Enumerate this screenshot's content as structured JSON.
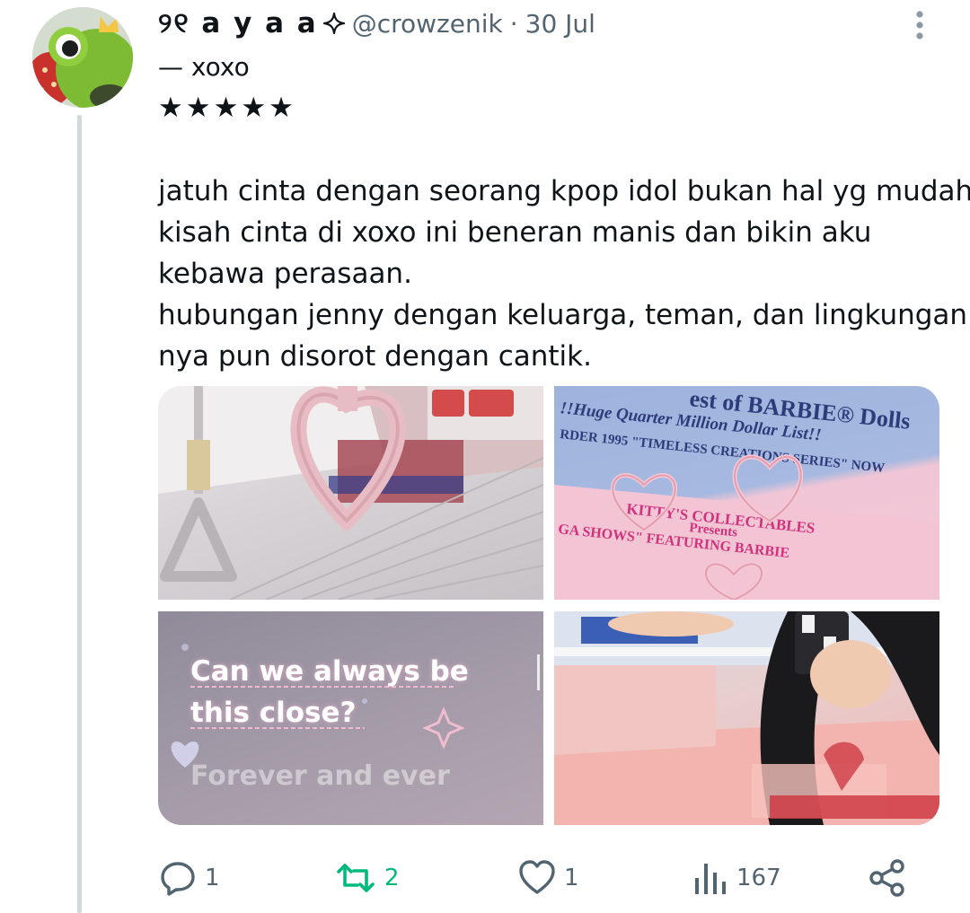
{
  "tweet": {
    "display_name": "୨୧ a y a a",
    "handle": "@crowzenik",
    "separator": "·",
    "date": "30 Jul",
    "line1": "— xoxo",
    "line2": "★★★★★",
    "body_lines": [
      "jatuh cinta dengan seorang kpop idol bukan hal yg mudah.",
      "kisah cinta di xoxo ini beneran manis dan bikin aku",
      "kebawa perasaan.",
      "hubungan jenny dengan keluarga, teman, dan lingkungan",
      "nya pun disorot dengan cantik."
    ]
  },
  "media": {
    "tile2_text_1": "est of BARBIE® Dolls",
    "tile2_text_2": "!!Huge Quarter Million Dollar List!!",
    "tile2_text_3": "RDER 1995 \"TIMELESS CREATIONS SERIES\" NOW",
    "tile2_text_4": "KITTY'S COLLECTABLES",
    "tile2_text_5": "Presents",
    "tile2_text_6": "GA SHOWS\" FEATURING BARBIE",
    "quote_line_1": "Can we always be",
    "quote_line_2": "this close?",
    "quote_sub": "Forever and ever"
  },
  "actions": {
    "replies": "1",
    "reposts": "2",
    "likes": "1",
    "views": "167"
  },
  "icons": {
    "more": "more-vertical-icon",
    "reply": "reply-icon",
    "repost": "repost-icon",
    "like": "heart-icon",
    "views": "views-chart-icon",
    "share": "share-icon",
    "verified": "sparkle-icon"
  },
  "colors": {
    "text": "#0f1419",
    "secondary": "#536471",
    "repost_active": "#00ba7c",
    "thread_line": "#cfd9de"
  }
}
